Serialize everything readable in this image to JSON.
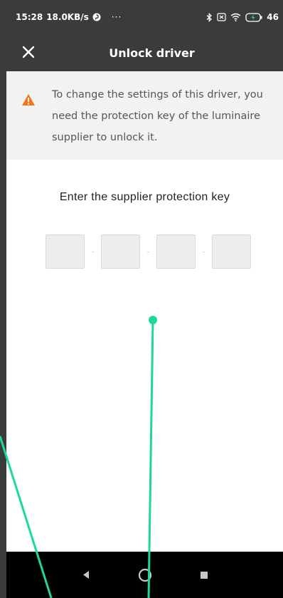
{
  "status_bar": {
    "time": "15:28",
    "speed": "18.0KB/s",
    "more": "···",
    "battery": "46"
  },
  "app_bar": {
    "title": "Unlock driver",
    "close_icon": "close-icon"
  },
  "warning": {
    "icon": "warning-icon",
    "color": "#f2741d",
    "text": "To change the settings of this driver, you need the protection key of the luminaire supplier to unlock it."
  },
  "key_entry": {
    "prompt": "Enter the supplier protection key",
    "separator": "-",
    "fields": [
      "",
      "",
      "",
      ""
    ]
  },
  "nav_bar": {
    "back": "back-triangle-icon",
    "home": "home-circle-icon",
    "recents": "recents-square-icon"
  },
  "colors": {
    "bar": "#3a3b3d",
    "annotation": "#1ed993"
  }
}
